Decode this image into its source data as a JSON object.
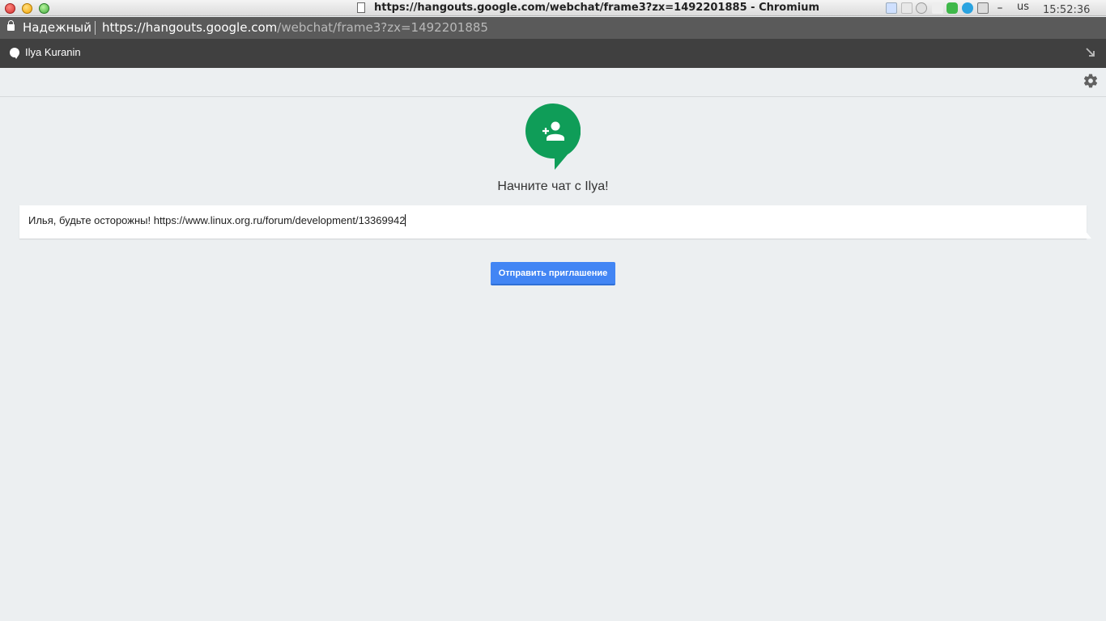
{
  "window": {
    "title": "https://hangouts.google.com/webchat/frame3?zx=1492201885 - Chromium",
    "keyboard_layout": "us",
    "clock": "15:52:36"
  },
  "urlbar": {
    "security_label": "Надежный",
    "url_scheme": "https://",
    "url_host": "hangouts.google.com",
    "url_path": "/webchat/frame3?zx=1492201885"
  },
  "chat": {
    "contact_name": "Ilya Kuranin",
    "invite_prompt": "Начните чат с Ilya!",
    "message_value": "Илья, будьте осторожны! https://www.linux.org.ru/forum/development/13369942",
    "send_button_label": "Отправить приглашение"
  },
  "icons": {
    "avatar": "add-person-icon",
    "settings": "gear-icon",
    "popout": "popout-arrow-icon",
    "lock": "lock-icon"
  },
  "colors": {
    "accent": "#4285f4",
    "avatar_bg": "#0f9d58",
    "header_bg": "#404040",
    "urlbar_bg": "#5a5a5a",
    "page_bg": "#eceff1"
  }
}
